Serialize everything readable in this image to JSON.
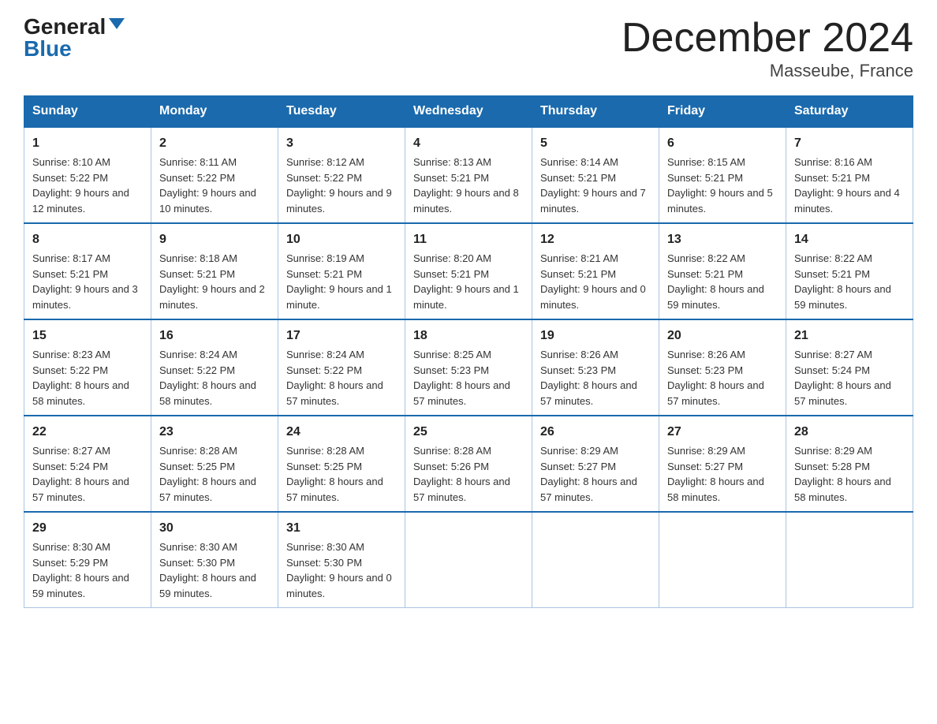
{
  "logo": {
    "general": "General",
    "blue": "Blue"
  },
  "title": "December 2024",
  "subtitle": "Masseube, France",
  "days_of_week": [
    "Sunday",
    "Monday",
    "Tuesday",
    "Wednesday",
    "Thursday",
    "Friday",
    "Saturday"
  ],
  "weeks": [
    [
      {
        "day": "1",
        "sunrise": "Sunrise: 8:10 AM",
        "sunset": "Sunset: 5:22 PM",
        "daylight": "Daylight: 9 hours and 12 minutes."
      },
      {
        "day": "2",
        "sunrise": "Sunrise: 8:11 AM",
        "sunset": "Sunset: 5:22 PM",
        "daylight": "Daylight: 9 hours and 10 minutes."
      },
      {
        "day": "3",
        "sunrise": "Sunrise: 8:12 AM",
        "sunset": "Sunset: 5:22 PM",
        "daylight": "Daylight: 9 hours and 9 minutes."
      },
      {
        "day": "4",
        "sunrise": "Sunrise: 8:13 AM",
        "sunset": "Sunset: 5:21 PM",
        "daylight": "Daylight: 9 hours and 8 minutes."
      },
      {
        "day": "5",
        "sunrise": "Sunrise: 8:14 AM",
        "sunset": "Sunset: 5:21 PM",
        "daylight": "Daylight: 9 hours and 7 minutes."
      },
      {
        "day": "6",
        "sunrise": "Sunrise: 8:15 AM",
        "sunset": "Sunset: 5:21 PM",
        "daylight": "Daylight: 9 hours and 5 minutes."
      },
      {
        "day": "7",
        "sunrise": "Sunrise: 8:16 AM",
        "sunset": "Sunset: 5:21 PM",
        "daylight": "Daylight: 9 hours and 4 minutes."
      }
    ],
    [
      {
        "day": "8",
        "sunrise": "Sunrise: 8:17 AM",
        "sunset": "Sunset: 5:21 PM",
        "daylight": "Daylight: 9 hours and 3 minutes."
      },
      {
        "day": "9",
        "sunrise": "Sunrise: 8:18 AM",
        "sunset": "Sunset: 5:21 PM",
        "daylight": "Daylight: 9 hours and 2 minutes."
      },
      {
        "day": "10",
        "sunrise": "Sunrise: 8:19 AM",
        "sunset": "Sunset: 5:21 PM",
        "daylight": "Daylight: 9 hours and 1 minute."
      },
      {
        "day": "11",
        "sunrise": "Sunrise: 8:20 AM",
        "sunset": "Sunset: 5:21 PM",
        "daylight": "Daylight: 9 hours and 1 minute."
      },
      {
        "day": "12",
        "sunrise": "Sunrise: 8:21 AM",
        "sunset": "Sunset: 5:21 PM",
        "daylight": "Daylight: 9 hours and 0 minutes."
      },
      {
        "day": "13",
        "sunrise": "Sunrise: 8:22 AM",
        "sunset": "Sunset: 5:21 PM",
        "daylight": "Daylight: 8 hours and 59 minutes."
      },
      {
        "day": "14",
        "sunrise": "Sunrise: 8:22 AM",
        "sunset": "Sunset: 5:21 PM",
        "daylight": "Daylight: 8 hours and 59 minutes."
      }
    ],
    [
      {
        "day": "15",
        "sunrise": "Sunrise: 8:23 AM",
        "sunset": "Sunset: 5:22 PM",
        "daylight": "Daylight: 8 hours and 58 minutes."
      },
      {
        "day": "16",
        "sunrise": "Sunrise: 8:24 AM",
        "sunset": "Sunset: 5:22 PM",
        "daylight": "Daylight: 8 hours and 58 minutes."
      },
      {
        "day": "17",
        "sunrise": "Sunrise: 8:24 AM",
        "sunset": "Sunset: 5:22 PM",
        "daylight": "Daylight: 8 hours and 57 minutes."
      },
      {
        "day": "18",
        "sunrise": "Sunrise: 8:25 AM",
        "sunset": "Sunset: 5:23 PM",
        "daylight": "Daylight: 8 hours and 57 minutes."
      },
      {
        "day": "19",
        "sunrise": "Sunrise: 8:26 AM",
        "sunset": "Sunset: 5:23 PM",
        "daylight": "Daylight: 8 hours and 57 minutes."
      },
      {
        "day": "20",
        "sunrise": "Sunrise: 8:26 AM",
        "sunset": "Sunset: 5:23 PM",
        "daylight": "Daylight: 8 hours and 57 minutes."
      },
      {
        "day": "21",
        "sunrise": "Sunrise: 8:27 AM",
        "sunset": "Sunset: 5:24 PM",
        "daylight": "Daylight: 8 hours and 57 minutes."
      }
    ],
    [
      {
        "day": "22",
        "sunrise": "Sunrise: 8:27 AM",
        "sunset": "Sunset: 5:24 PM",
        "daylight": "Daylight: 8 hours and 57 minutes."
      },
      {
        "day": "23",
        "sunrise": "Sunrise: 8:28 AM",
        "sunset": "Sunset: 5:25 PM",
        "daylight": "Daylight: 8 hours and 57 minutes."
      },
      {
        "day": "24",
        "sunrise": "Sunrise: 8:28 AM",
        "sunset": "Sunset: 5:25 PM",
        "daylight": "Daylight: 8 hours and 57 minutes."
      },
      {
        "day": "25",
        "sunrise": "Sunrise: 8:28 AM",
        "sunset": "Sunset: 5:26 PM",
        "daylight": "Daylight: 8 hours and 57 minutes."
      },
      {
        "day": "26",
        "sunrise": "Sunrise: 8:29 AM",
        "sunset": "Sunset: 5:27 PM",
        "daylight": "Daylight: 8 hours and 57 minutes."
      },
      {
        "day": "27",
        "sunrise": "Sunrise: 8:29 AM",
        "sunset": "Sunset: 5:27 PM",
        "daylight": "Daylight: 8 hours and 58 minutes."
      },
      {
        "day": "28",
        "sunrise": "Sunrise: 8:29 AM",
        "sunset": "Sunset: 5:28 PM",
        "daylight": "Daylight: 8 hours and 58 minutes."
      }
    ],
    [
      {
        "day": "29",
        "sunrise": "Sunrise: 8:30 AM",
        "sunset": "Sunset: 5:29 PM",
        "daylight": "Daylight: 8 hours and 59 minutes."
      },
      {
        "day": "30",
        "sunrise": "Sunrise: 8:30 AM",
        "sunset": "Sunset: 5:30 PM",
        "daylight": "Daylight: 8 hours and 59 minutes."
      },
      {
        "day": "31",
        "sunrise": "Sunrise: 8:30 AM",
        "sunset": "Sunset: 5:30 PM",
        "daylight": "Daylight: 9 hours and 0 minutes."
      },
      null,
      null,
      null,
      null
    ]
  ]
}
